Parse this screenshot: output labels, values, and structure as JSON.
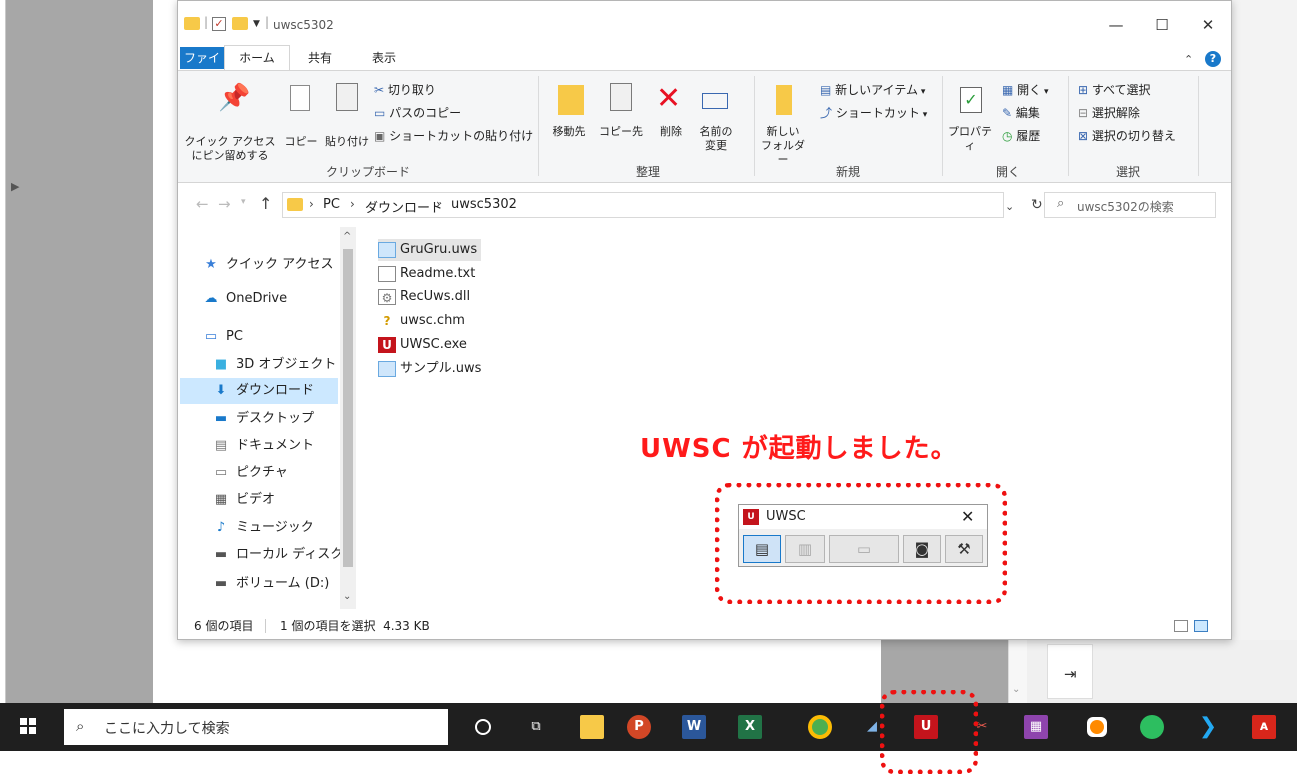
{
  "window": {
    "title": "uwsc5302",
    "controls": {
      "minimize": "—",
      "maximize": "☐",
      "close": "✕"
    }
  },
  "tabs": {
    "file": "ファイル",
    "home": "ホーム",
    "share": "共有",
    "view": "表示"
  },
  "ribbon": {
    "clipboard": {
      "group": "クリップボード",
      "pin_line1": "クイック アクセス",
      "pin_line2": "にピン留めする",
      "copy": "コピー",
      "paste": "貼り付け",
      "cut": "切り取り",
      "copy_path": "パスのコピー",
      "paste_shortcut": "ショートカットの貼り付け"
    },
    "organize": {
      "group": "整理",
      "move_to": "移動先",
      "copy_to": "コピー先",
      "delete": "削除",
      "rename_line1": "名前の",
      "rename_line2": "変更"
    },
    "new": {
      "group": "新規",
      "new_folder_line1": "新しい",
      "new_folder_line2": "フォルダー",
      "new_item": "新しいアイテム",
      "shortcut": "ショートカット"
    },
    "open": {
      "group": "開く",
      "properties": "プロパティ",
      "open": "開く",
      "edit": "編集",
      "history": "履歴"
    },
    "select": {
      "group": "選択",
      "select_all": "すべて選択",
      "select_none": "選択解除",
      "invert": "選択の切り替え"
    }
  },
  "address": {
    "pc": "PC",
    "downloads": "ダウンロード",
    "current": "uwsc5302",
    "search_placeholder": "uwsc5302の検索"
  },
  "nav": {
    "items": [
      {
        "label": "クイック アクセス",
        "icon": "star-icon"
      },
      {
        "label": "OneDrive",
        "icon": "cloud-icon"
      },
      {
        "label": "PC",
        "icon": "monitor-icon"
      },
      {
        "label": "3D オブジェクト",
        "icon": "cube-icon"
      },
      {
        "label": "ダウンロード",
        "icon": "download-icon"
      },
      {
        "label": "デスクトップ",
        "icon": "desktop-icon"
      },
      {
        "label": "ドキュメント",
        "icon": "document-icon"
      },
      {
        "label": "ピクチャ",
        "icon": "picture-icon"
      },
      {
        "label": "ビデオ",
        "icon": "video-icon"
      },
      {
        "label": "ミュージック",
        "icon": "music-icon"
      },
      {
        "label": "ローカル ディスク (C",
        "icon": "drive-icon"
      },
      {
        "label": "ボリューム (D:)",
        "icon": "volume-icon"
      }
    ]
  },
  "files": [
    {
      "name": "GruGru.uws",
      "icon": "uws-file-icon"
    },
    {
      "name": "Readme.txt",
      "icon": "text-file-icon"
    },
    {
      "name": "RecUws.dll",
      "icon": "dll-file-icon"
    },
    {
      "name": "uwsc.chm",
      "icon": "help-file-icon"
    },
    {
      "name": "UWSC.exe",
      "icon": "uwsc-exe-icon"
    },
    {
      "name": "サンプル.uws",
      "icon": "uws-file-icon"
    }
  ],
  "status": {
    "count": "6 個の項目",
    "selection": "1 個の項目を選択  4.33 KB"
  },
  "annotation": {
    "text": "UWSC が起動しました。"
  },
  "uwsc": {
    "title": "UWSC",
    "close": "✕"
  },
  "taskbar": {
    "search_placeholder": "ここに入力して検索"
  },
  "colors": {
    "accent": "#1979ca",
    "annotation": "#ff1a1a",
    "taskbar": "#1f1f1f"
  }
}
